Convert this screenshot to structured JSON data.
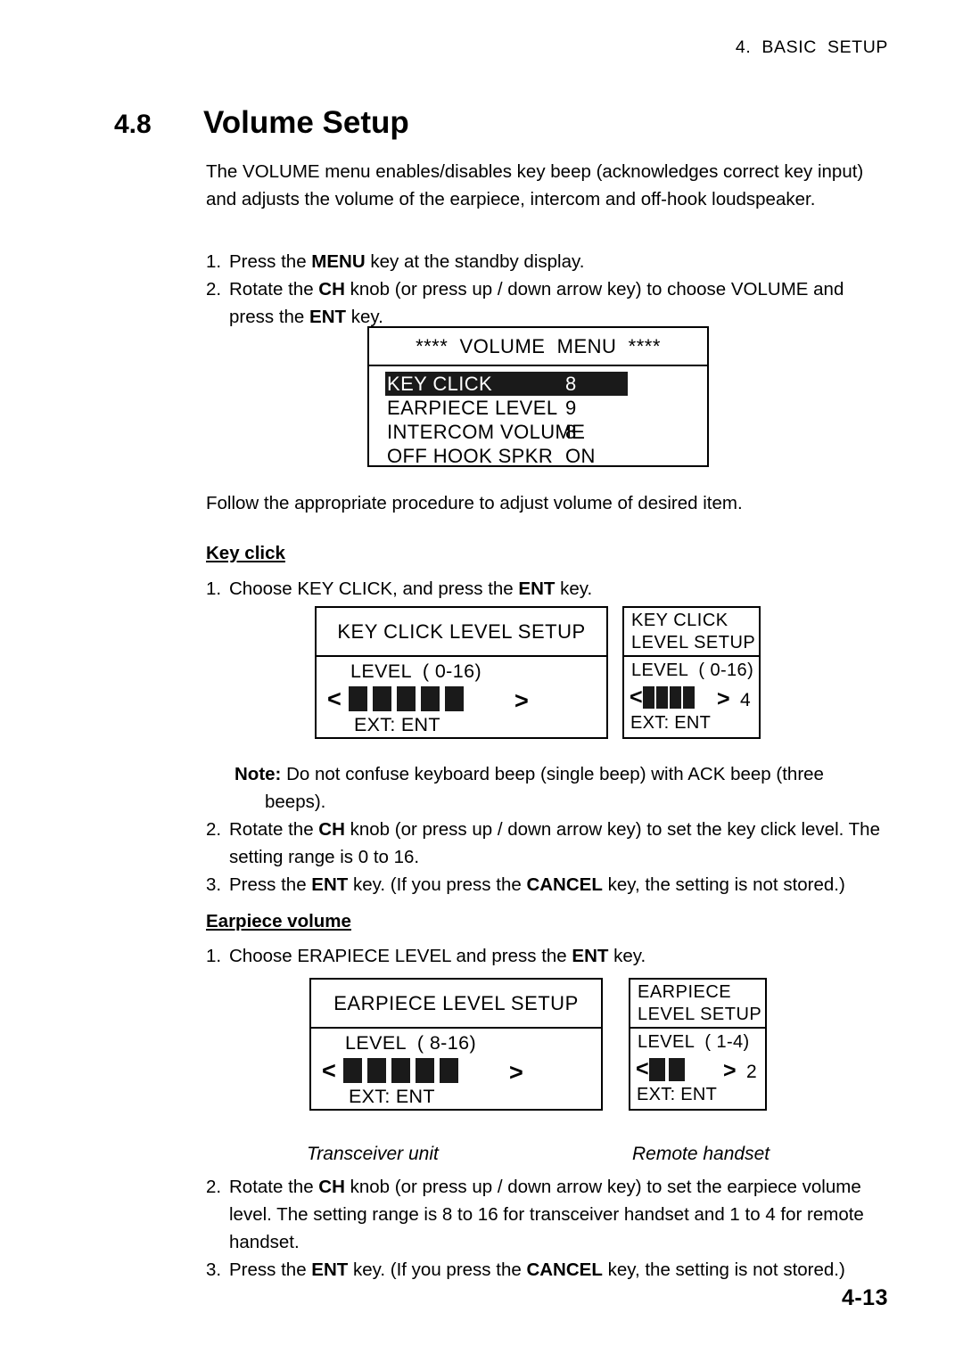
{
  "running_head": "4.  BASIC  SETUP",
  "heading": {
    "number": "4.8",
    "title": "Volume Setup"
  },
  "intro": "The VOLUME menu enables/disables key beep (acknowledges correct key input) and adjusts the volume of the earpiece, intercom and off-hook loudspeaker.",
  "steps_top": [
    {
      "num": "1.",
      "html": "Press the <b>MENU</b> key at the standby display."
    },
    {
      "num": "2.",
      "html": "Rotate the <b>CH</b> knob (or press up / down arrow key) to choose VOLUME and press the <b>ENT</b> key."
    }
  ],
  "volume_menu": {
    "title": "****  VOLUME  MENU  ****",
    "rows": [
      {
        "label": "KEY CLICK",
        "value": "8",
        "highlighted": true
      },
      {
        "label": "EARPIECE LEVEL",
        "value": "9",
        "highlighted": false
      },
      {
        "label": "INTERCOM VOLUME",
        "value": "8",
        "highlighted": false
      },
      {
        "label": "OFF HOOK SPKR",
        "value": "ON",
        "highlighted": false
      }
    ]
  },
  "follow_text": "Follow the appropriate procedure to adjust volume of desired item.",
  "key_click": {
    "subhead": "Key click",
    "step1": {
      "num": "1.",
      "html": "Choose KEY CLICK, and press the <b>ENT</b> key."
    },
    "transceiver": {
      "title": "KEY CLICK LEVEL SETUP",
      "level_label": "LEVEL  ( 0-16)",
      "left_caret": "<",
      "right_caret": ">",
      "bars": 5,
      "ext": "EXT: ENT"
    },
    "remote": {
      "title_line1": "KEY CLICK",
      "title_line2": "LEVEL SETUP",
      "level_label": "LEVEL  ( 0-16)",
      "left_caret": "<",
      "right_caret": ">",
      "bars": 4,
      "value": "4",
      "ext": "EXT: ENT"
    },
    "note": {
      "label": "Note:",
      "line1": "Do not confuse keyboard beep (single beep) with ACK beep (three",
      "line2": "beeps)."
    },
    "steps": [
      {
        "num": "2.",
        "html": "Rotate the <b>CH</b> knob (or press up / down arrow key) to set the key click level. The setting range is 0 to 16."
      },
      {
        "num": "3.",
        "html": "Press the <b>ENT</b> key. (If you press the <b>CANCEL</b> key, the setting is not stored.)"
      }
    ]
  },
  "earpiece_volume": {
    "subhead": "Earpiece volume",
    "step1": {
      "num": "1.",
      "html": "Choose ERAPIECE LEVEL and press the <b>ENT</b> key."
    },
    "transceiver": {
      "title": "EARPIECE LEVEL SETUP",
      "level_label": "LEVEL  ( 8-16)",
      "left_caret": "<",
      "right_caret": ">",
      "bars": 5,
      "ext": "EXT: ENT"
    },
    "remote": {
      "title_line1": "EARPIECE",
      "title_line2": "LEVEL SETUP",
      "level_label": "LEVEL  ( 1-4)",
      "left_caret": "<",
      "right_caret": ">",
      "bars": 2,
      "value": "2",
      "ext": "EXT: ENT"
    },
    "caption_transceiver": "Transceiver unit",
    "caption_remote": "Remote handset",
    "steps": [
      {
        "num": "2.",
        "html": "Rotate the <b>CH</b> knob (or press up / down arrow key) to set the earpiece volume level. The setting range is 8 to 16 for transceiver handset and 1 to 4 for remote handset."
      },
      {
        "num": "3.",
        "html": "Press the <b>ENT</b> key. (If you press the <b>CANCEL</b> key, the setting is not stored.)"
      }
    ]
  },
  "folio": "4-13"
}
